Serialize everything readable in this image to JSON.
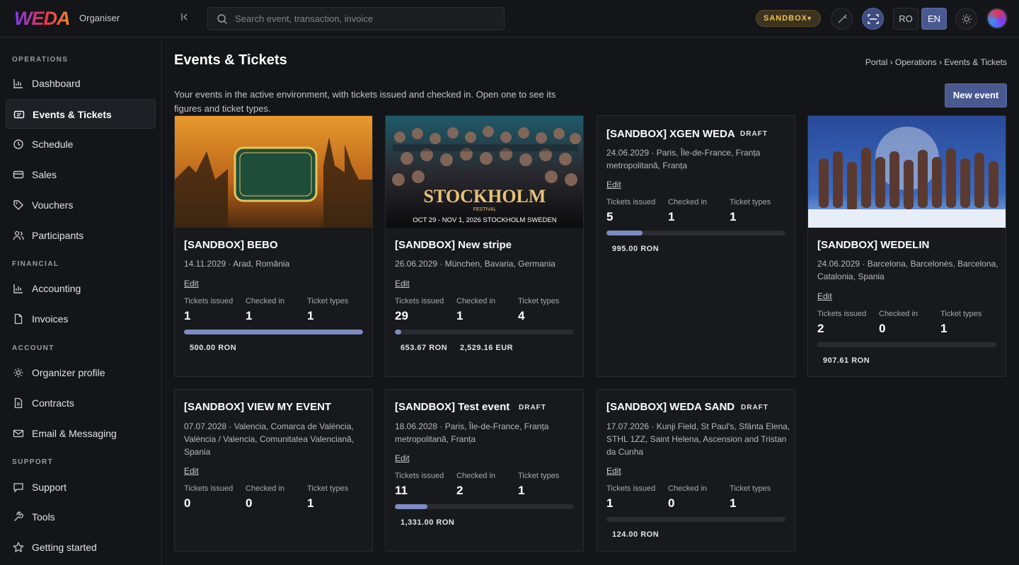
{
  "app": {
    "logo": "WEDA",
    "org_label": "Organiser"
  },
  "search": {
    "placeholder": "Search event, transaction, invoice"
  },
  "topbar": {
    "env_badge": "SANDBOX",
    "langs": [
      "RO",
      "EN"
    ],
    "active_lang": "EN"
  },
  "sidebar": {
    "sections": [
      {
        "title": "OPERATIONS",
        "items": [
          {
            "label": "Dashboard",
            "icon": "chart-bar-icon"
          },
          {
            "label": "Events & Tickets",
            "icon": "ticket-icon",
            "active": true
          },
          {
            "label": "Schedule",
            "icon": "clock-icon"
          },
          {
            "label": "Sales",
            "icon": "credit-card-icon"
          },
          {
            "label": "Vouchers",
            "icon": "tag-icon"
          },
          {
            "label": "Participants",
            "icon": "users-icon"
          }
        ]
      },
      {
        "title": "FINANCIAL",
        "items": [
          {
            "label": "Accounting",
            "icon": "chart-bar-icon"
          },
          {
            "label": "Invoices",
            "icon": "document-icon"
          }
        ]
      },
      {
        "title": "ACCOUNT",
        "items": [
          {
            "label": "Organizer profile",
            "icon": "gear-icon"
          },
          {
            "label": "Contracts",
            "icon": "document-icon"
          },
          {
            "label": "Email & Messaging",
            "icon": "mail-icon"
          }
        ]
      },
      {
        "title": "SUPPORT",
        "items": [
          {
            "label": "Support",
            "icon": "chat-icon"
          },
          {
            "label": "Tools",
            "icon": "wrench-icon"
          },
          {
            "label": "Getting started",
            "icon": "star-icon"
          }
        ]
      }
    ]
  },
  "page": {
    "title": "Events & Tickets",
    "breadcrumb": [
      "Portal",
      "Operations",
      "Events & Tickets"
    ],
    "subtitle": "Your events in the active environment, with tickets issued and checked in. Open one to see its figures and ticket types.",
    "new_event_label": "New event"
  },
  "stat_labels": {
    "issued": "Tickets issued",
    "checked": "Checked in",
    "types": "Ticket types"
  },
  "edit_label": "Edit",
  "events": [
    {
      "title": "[SANDBOX] BEBO",
      "date": "14.11.2029",
      "location": "Arad, România",
      "issued": "1",
      "checked": "1",
      "types": "1",
      "progress": 1.0,
      "amounts": [
        "500.00 RON"
      ],
      "image": "latin-nation-poster"
    },
    {
      "title": "[SANDBOX] New stripe",
      "date": "26.06.2029",
      "location": "München, Bavaria, Germania",
      "issued": "29",
      "checked": "1",
      "types": "4",
      "progress": 0.034,
      "amounts": [
        "653.67 RON",
        "2,529.16 EUR"
      ],
      "image": "stockholm-festival-poster",
      "poster_text": "STOCKHOLM",
      "poster_sub": "FESTIVAL",
      "poster_dates": "OCT 29 - NOV 1, 2026 STOCKHOLM SWEDEN"
    },
    {
      "title": "[SANDBOX] XGEN WEDA",
      "badge": "DRAFT",
      "date": "24.06.2029",
      "location": "Paris, Île-de-France, Franța metropolitană, Franța",
      "issued": "5",
      "checked": "1",
      "types": "1",
      "progress": 0.2,
      "amounts": [
        "995.00 RON"
      ]
    },
    {
      "title": "[SANDBOX] WEDELIN",
      "date": "24.06.2029",
      "location": "Barcelona, Barcelonès, Barcelona, Catalonia, Spania",
      "issued": "2",
      "checked": "0",
      "types": "1",
      "progress": 0.0,
      "amounts": [
        "907.61 RON"
      ],
      "image": "cast-photo"
    },
    {
      "title": "[SANDBOX] VIEW MY EVENT",
      "date": "07.07.2028",
      "location": "Valencia, Comarca de València, València / Valencia, Comunitatea Valenciană, Spania",
      "issued": "0",
      "checked": "0",
      "types": "1",
      "progress": 0.0,
      "amounts": []
    },
    {
      "title": "[SANDBOX] Test event",
      "badge": "DRAFT",
      "date": "18.06.2028",
      "location": "Paris, Île-de-France, Franța metropolitană, Franța",
      "issued": "11",
      "checked": "2",
      "types": "1",
      "progress": 0.18,
      "amounts": [
        "1,331.00 RON"
      ]
    },
    {
      "title": "[SANDBOX] WEDA SAND",
      "badge": "DRAFT",
      "date": "17.07.2026",
      "location": "Kunji Field, St Paul's, Sfânta Elena, STHL 1ZZ, Saint Helena, Ascension and Tristan da Cunha",
      "issued": "1",
      "checked": "0",
      "types": "1",
      "progress": 0.0,
      "amounts": [
        "124.00 RON"
      ]
    }
  ]
}
